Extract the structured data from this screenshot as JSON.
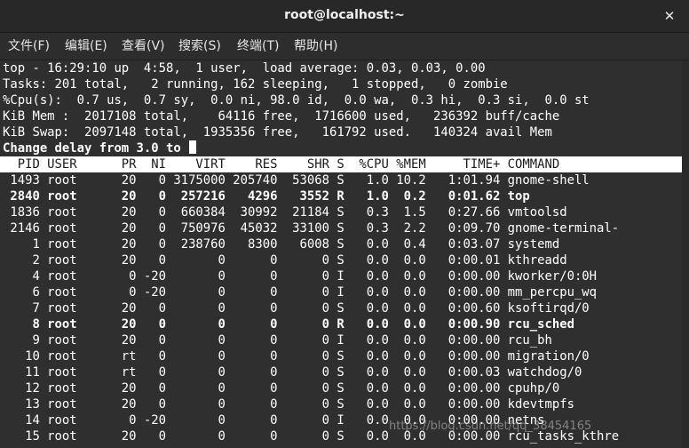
{
  "window": {
    "title": "root@localhost:~",
    "close_icon": "close-icon"
  },
  "menu": [
    {
      "label": "文件(F)"
    },
    {
      "label": "编辑(E)"
    },
    {
      "label": "查看(V)"
    },
    {
      "label": "搜索(S)"
    },
    {
      "label": "终端(T)"
    },
    {
      "label": "帮助(H)"
    }
  ],
  "summary": [
    "top - 16:29:10 up  4:58,  1 user,  load average: 0.03, 0.03, 0.00",
    "Tasks: 201 total,   2 running, 162 sleeping,   1 stopped,   0 zombie",
    "%Cpu(s):  0.7 us,  0.7 sy,  0.0 ni, 98.0 id,  0.0 wa,  0.3 hi,  0.3 si,  0.0 st",
    "KiB Mem :  2017108 total,    64116 free,  1716600 used,   236392 buff/cache",
    "KiB Swap:  2097148 total,  1935356 free,   161792 used.   140324 avail Mem"
  ],
  "prompt": "Change delay from 3.0 to ",
  "header": "  PID USER      PR  NI    VIRT    RES    SHR S  %CPU %MEM     TIME+ COMMAND",
  "processes": [
    {
      "text": " 1493 root      20   0 3175000 205740  53068 S   1.0 10.2   1:01.94 gnome-shell",
      "bold": false
    },
    {
      "text": " 2840 root      20   0  257216   4296   3552 R   1.0  0.2   0:01.62 top",
      "bold": true
    },
    {
      "text": " 1836 root      20   0  660384  30992  21184 S   0.3  1.5   0:27.66 vmtoolsd",
      "bold": false
    },
    {
      "text": " 2146 root      20   0  750976  45032  33100 S   0.3  2.2   0:09.70 gnome-terminal-",
      "bold": false
    },
    {
      "text": "    1 root      20   0  238760   8300   6008 S   0.0  0.4   0:03.07 systemd",
      "bold": false
    },
    {
      "text": "    2 root      20   0       0      0      0 S   0.0  0.0   0:00.01 kthreadd",
      "bold": false
    },
    {
      "text": "    4 root       0 -20       0      0      0 I   0.0  0.0   0:00.00 kworker/0:0H",
      "bold": false
    },
    {
      "text": "    6 root       0 -20       0      0      0 I   0.0  0.0   0:00.00 mm_percpu_wq",
      "bold": false
    },
    {
      "text": "    7 root      20   0       0      0      0 S   0.0  0.0   0:00.60 ksoftirqd/0",
      "bold": false
    },
    {
      "text": "    8 root      20   0       0      0      0 R   0.0  0.0   0:00.90 rcu_sched",
      "bold": true
    },
    {
      "text": "    9 root      20   0       0      0      0 I   0.0  0.0   0:00.00 rcu_bh",
      "bold": false
    },
    {
      "text": "   10 root      rt   0       0      0      0 S   0.0  0.0   0:00.00 migration/0",
      "bold": false
    },
    {
      "text": "   11 root      rt   0       0      0      0 S   0.0  0.0   0:00.03 watchdog/0",
      "bold": false
    },
    {
      "text": "   12 root      20   0       0      0      0 S   0.0  0.0   0:00.00 cpuhp/0",
      "bold": false
    },
    {
      "text": "   13 root      20   0       0      0      0 S   0.0  0.0   0:00.00 kdevtmpfs",
      "bold": false
    },
    {
      "text": "   14 root       0 -20       0      0      0 I   0.0  0.0   0:00.00 netns",
      "bold": false
    },
    {
      "text": "   15 root      20   0       0      0      0 S   0.0  0.0   0:00.00 rcu_tasks_kthre",
      "bold": false
    }
  ],
  "watermark": "https://blog.csdn.net/qq_38454165"
}
